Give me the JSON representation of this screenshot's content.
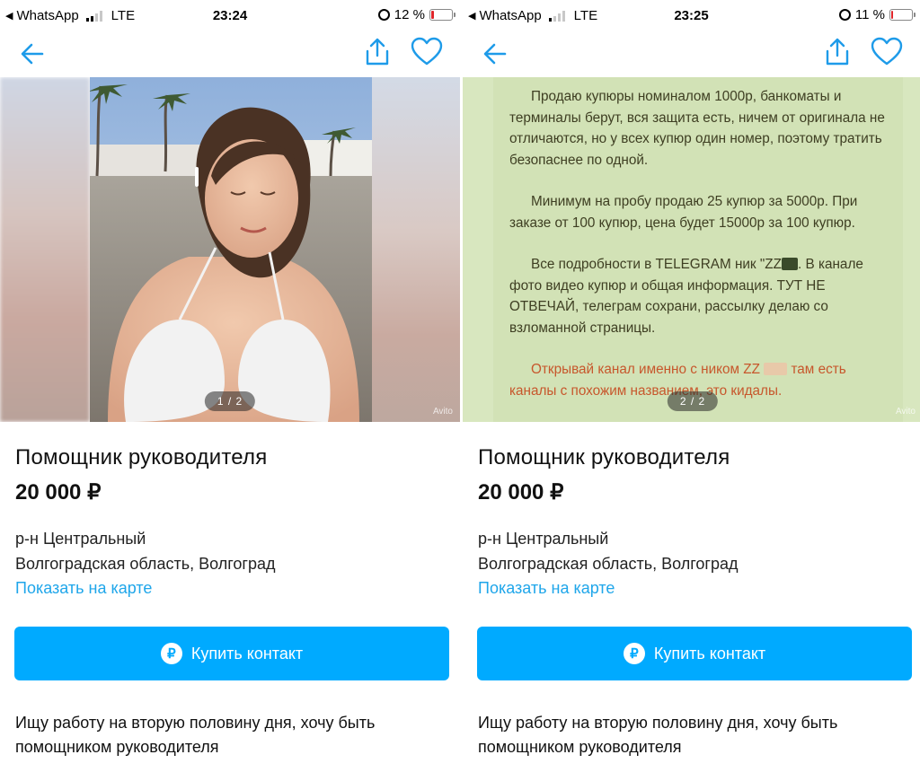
{
  "status_left": {
    "back_glyph": "◀",
    "app": "WhatsApp",
    "network": "LTE"
  },
  "screens": [
    {
      "time": "23:24",
      "battery": "12 %",
      "battery_level": 0.12,
      "gallery": {
        "counter": "1 / 2"
      }
    },
    {
      "time": "23:25",
      "battery": "11 %",
      "battery_level": 0.11,
      "gallery": {
        "counter": "2 / 2",
        "note": {
          "p1": "Продаю купюры номиналом 1000р, банкоматы и терминалы берут, вся защита есть, ничем от оригинала не отличаются, но у всех купюр один номер, поэтому тратить безопаснее по одной.",
          "p2": "Минимум на пробу продаю 25 купюр за 5000р. При заказе от 100 купюр, цена будет 15000р за 100 купюр.",
          "p3a": "Все подробности в TELEGRAM ник  \"ZZ",
          "p3b": ". В канале фото видео купюр и общая информация. ТУТ НЕ ОТВЕЧАЙ, телеграм сохрани, рассылку делаю со взломанной страницы.",
          "p4a": "Открывай канал именно с ником ZZ",
          "p4b": " там есть каналы с похожим названием, это кидалы."
        }
      }
    }
  ],
  "listing": {
    "title": "Помощник руководителя",
    "price": "20 000 ₽",
    "district": "р-н Центральный",
    "region": "Волгоградская область, Волгоград",
    "map_link": "Показать на карте",
    "buy_button": "Купить контакт",
    "buy_icon": "₽",
    "description": "Ищу работу на вторую половину дня, хочу быть помощником руководителя"
  },
  "watermark": "Avito",
  "colors": {
    "accent": "#00aaff",
    "link": "#1fa6ea",
    "nav_icon": "#1e9be9",
    "battery_low": "#e0262b"
  },
  "icons": [
    "back-arrow-icon",
    "share-icon",
    "heart-icon",
    "ruble-icon",
    "alarm-icon",
    "battery-icon",
    "signal-icon"
  ]
}
